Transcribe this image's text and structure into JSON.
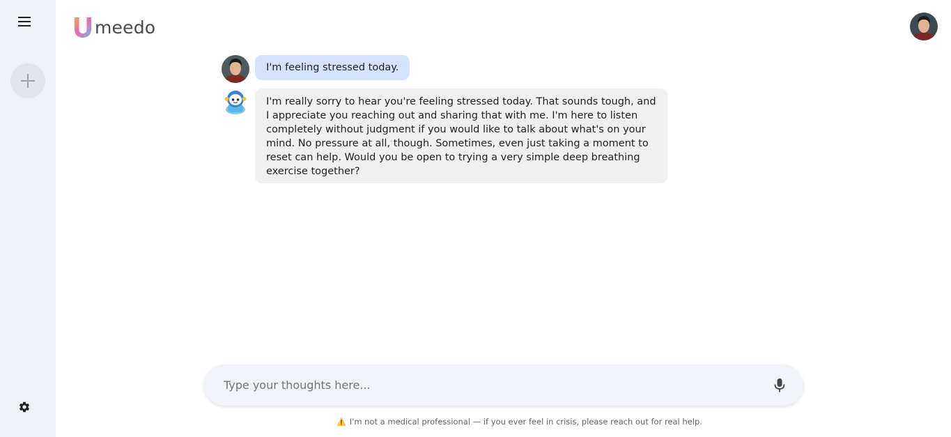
{
  "app": {
    "logo_letter": "U",
    "logo_text": "meedo"
  },
  "sidebar": {
    "menu_icon": "hamburger-menu-icon",
    "new_chat_icon": "plus-icon",
    "settings_icon": "gear-icon"
  },
  "chat": {
    "messages": [
      {
        "role": "user",
        "text": "I'm feeling stressed today."
      },
      {
        "role": "assistant",
        "text": "I'm really sorry to hear you're feeling stressed today. That sounds tough, and I appreciate you reaching out and sharing that with me. I'm here to listen completely without judgment if you would like to talk about what's on your mind. No pressure at all, though. Sometimes, even just taking a moment to reset can help. Would you be open to trying a very simple deep breathing exercise together?"
      }
    ]
  },
  "composer": {
    "placeholder": "Type your thoughts here...",
    "value": "",
    "mic_icon": "microphone-icon"
  },
  "footer": {
    "warning_icon": "warning-icon",
    "disclaimer": "I'm not a medical professional — if you ever feel in crisis, please reach out for real help."
  },
  "colors": {
    "sidebar_bg": "#eef1f5",
    "user_bubble": "#d3e3fd",
    "bot_bubble": "#f0f0f0",
    "composer_bg": "#f0f3f7"
  }
}
